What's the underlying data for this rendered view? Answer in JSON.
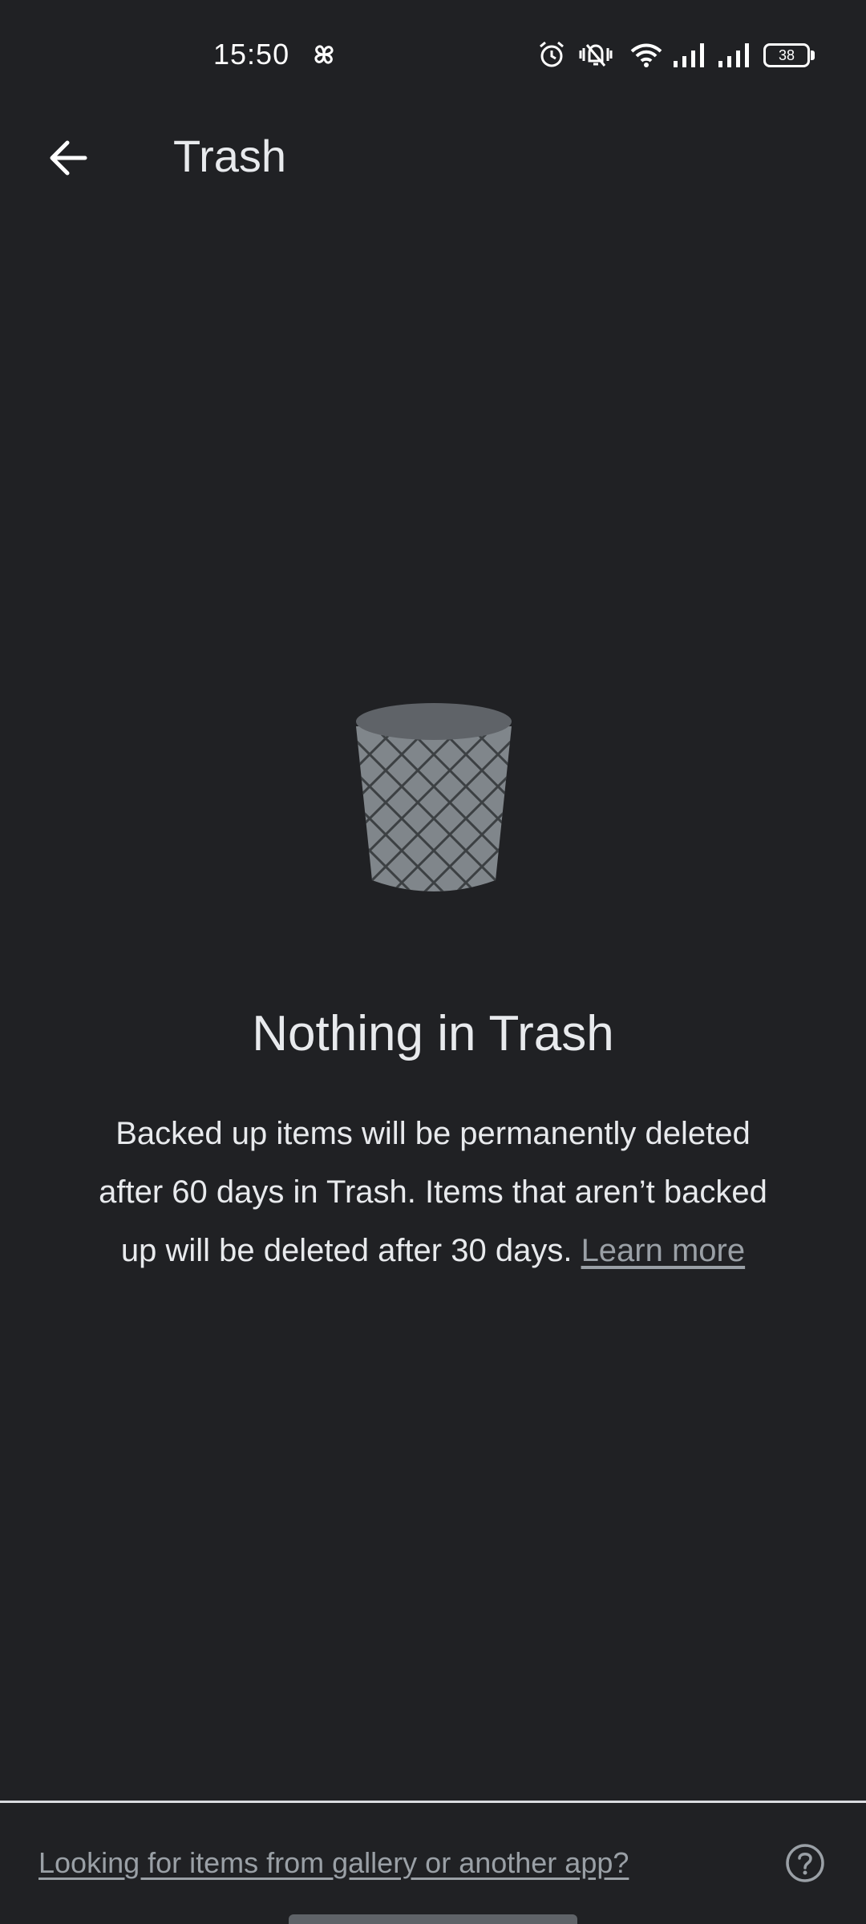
{
  "status_bar": {
    "time": "15:50",
    "battery": "38",
    "icons": [
      "pinwheel-icon",
      "alarm-icon",
      "vibrate-silent-icon",
      "wifi-icon",
      "signal-icon",
      "signal-icon"
    ]
  },
  "app_bar": {
    "title": "Trash",
    "back_icon": "arrow-back-icon"
  },
  "empty_state": {
    "illustration": "trash-bin-icon",
    "title": "Nothing in Trash",
    "body": "Backed up items will be permanently deleted after 60 days in Trash. Items that aren’t backed up will be deleted after 30 days.",
    "link": "Learn more"
  },
  "footer": {
    "link": "Looking for items from gallery or another app?",
    "help_icon": "help-circle-icon"
  },
  "colors": {
    "background": "#202124",
    "text": "#e8eaed",
    "muted": "#9aa0a6"
  }
}
